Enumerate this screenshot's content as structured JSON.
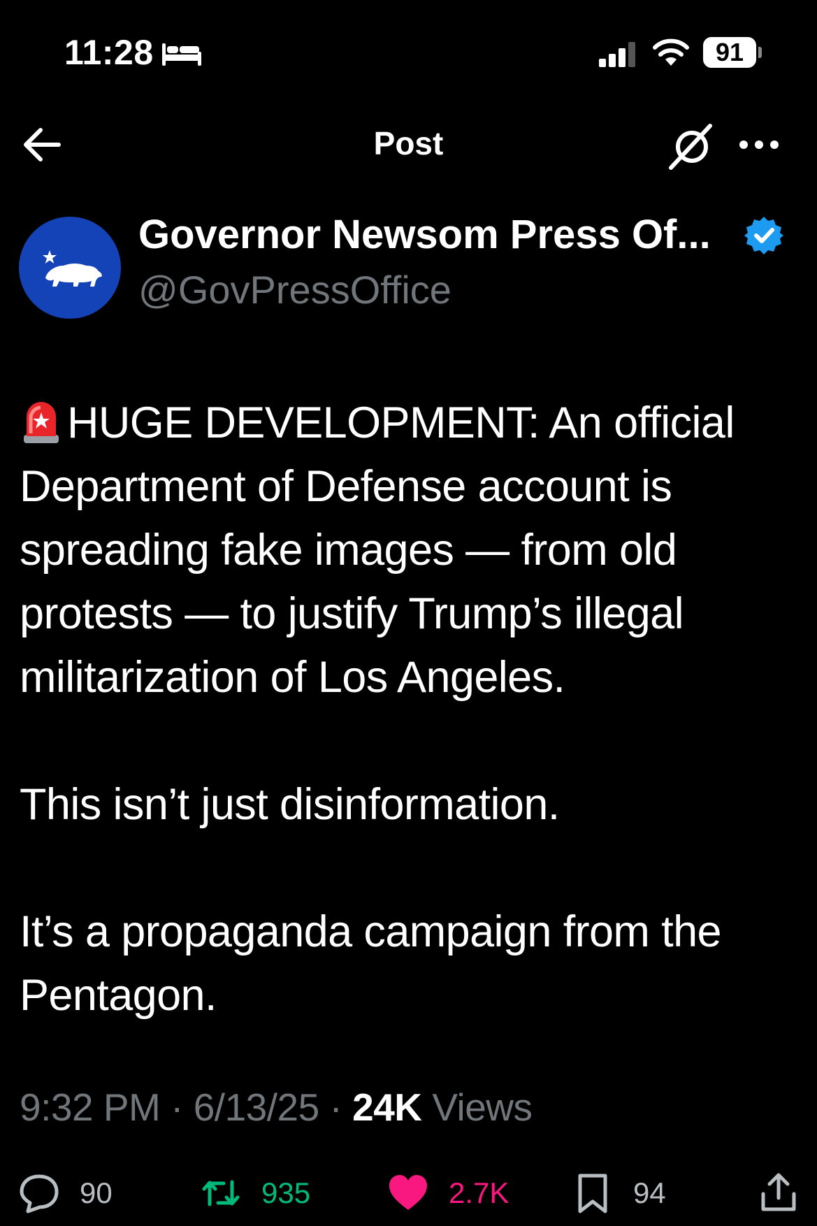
{
  "status_bar": {
    "time": "11:28",
    "battery": "91",
    "icons": [
      "bed-icon",
      "signal-icon",
      "wifi-icon",
      "battery-icon"
    ]
  },
  "nav": {
    "title": "Post",
    "icons": [
      "back-arrow-icon",
      "grok-icon",
      "more-icon"
    ]
  },
  "author": {
    "display_name": "Governor Newsom Press Of...",
    "handle": "@GovPressOffice",
    "verified": true
  },
  "post": {
    "paragraphs": [
      "HUGE DEVELOPMENT: An official Department of Defense account is spreading fake images — from old protests — to justify Trump’s illegal militarization of Los Angeles.",
      "This isn’t just disinformation.",
      "It’s a propaganda campaign from the Pentagon."
    ],
    "leading_emoji": "siren-icon"
  },
  "meta": {
    "time": "9:32 PM",
    "sep": "·",
    "date": "6/13/25",
    "views_count": "24K",
    "views_label": "Views"
  },
  "actions": {
    "replies": "90",
    "reposts": "935",
    "likes": "2.7K",
    "bookmarks": "94"
  },
  "colors": {
    "background": "#000000",
    "muted": "#71767b",
    "verified": "#1d9bf0",
    "repost": "#00ba7c",
    "like": "#f91880",
    "avatar": "#1443b8"
  }
}
